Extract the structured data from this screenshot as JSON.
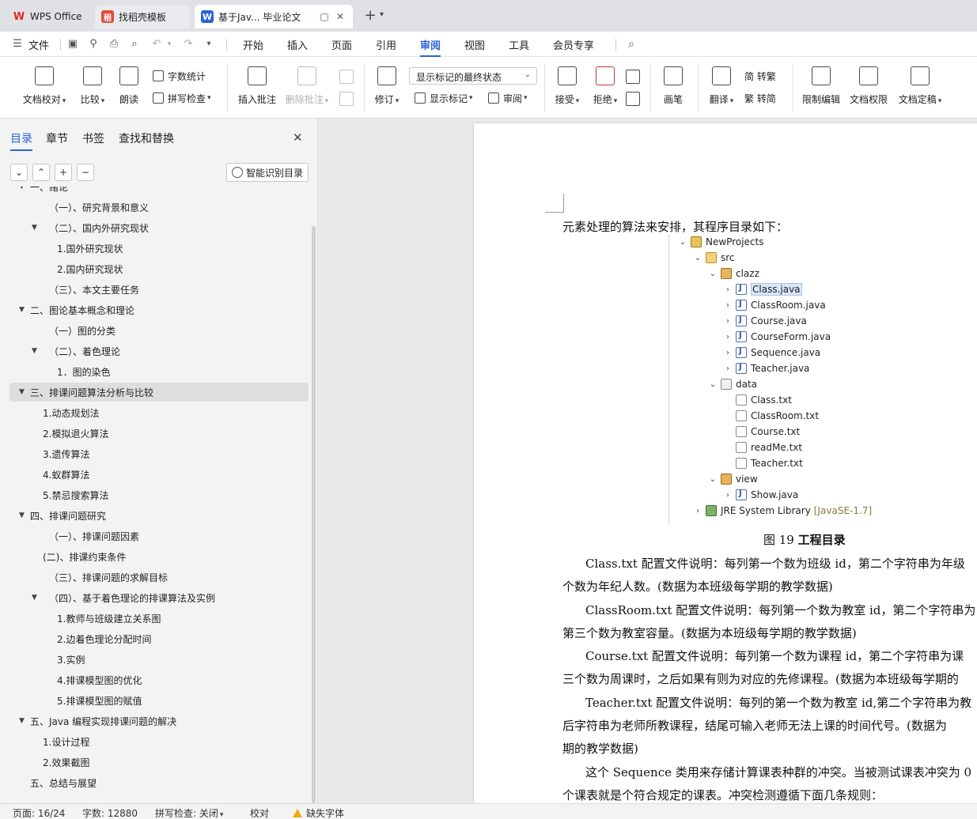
{
  "tabs": [
    {
      "label": "WPS Office",
      "icon": "wps-logo-icon"
    },
    {
      "label": "找稻壳模板",
      "icon": "docer-icon"
    },
    {
      "label": "基于Jav... 毕业论文",
      "icon": "word-doc-icon",
      "active": true
    }
  ],
  "menu": {
    "file": "文件",
    "items": [
      "开始",
      "插入",
      "页面",
      "引用",
      "审阅",
      "视图",
      "工具",
      "会员专享"
    ],
    "active": "审阅"
  },
  "ribbon": {
    "doc_check": "文档校对",
    "compare": "比较",
    "read_aloud": "朗读",
    "word_count": "字数统计",
    "spell_check": "拼写检查",
    "insert_comment": "插入批注",
    "delete_comment": "删除批注",
    "track": "修订",
    "markup_state": "显示标记的最终状态",
    "show_markup": "显示标记",
    "review_pane": "审阅",
    "accept": "接受",
    "reject": "拒绝",
    "pen": "画笔",
    "translate": "翻译",
    "to_traditional": "简 转繁",
    "to_simplified": "繁 转简",
    "restrict_edit": "限制编辑",
    "doc_permission": "文档权限",
    "finalize": "文档定稿"
  },
  "nav": {
    "tabs": [
      "目录",
      "章节",
      "书签",
      "查找和替换"
    ],
    "active_tab": "目录",
    "smart_toc": "智能识别目录",
    "toc": [
      {
        "label": "一、绪论",
        "level": 0,
        "expanded": true,
        "partial": true
      },
      {
        "label": "（一）、研究背景和意义",
        "level": 2
      },
      {
        "label": "（二）、国内外研究现状",
        "level": 1,
        "expanded": true
      },
      {
        "label": "1.国外研究现状",
        "level": 3
      },
      {
        "label": "2.国内研究现状",
        "level": 3
      },
      {
        "label": "（三）、本文主要任务",
        "level": 2
      },
      {
        "label": "二、图论基本概念和理论",
        "level": 0,
        "expanded": true
      },
      {
        "label": "（一）图的分类",
        "level": 2
      },
      {
        "label": "（二）、着色理论",
        "level": 1,
        "expanded": true
      },
      {
        "label": "1．图的染色",
        "level": 3
      },
      {
        "label": "三、排课问题算法分析与比较",
        "level": 0,
        "expanded": true,
        "selected": true
      },
      {
        "label": "1.动态规划法",
        "level": 4
      },
      {
        "label": "2.模拟退火算法",
        "level": 4
      },
      {
        "label": "3.遗传算法",
        "level": 4
      },
      {
        "label": "4.蚁群算法",
        "level": 4
      },
      {
        "label": "5.禁忌搜索算法",
        "level": 4
      },
      {
        "label": "四、排课问题研究",
        "level": 0,
        "expanded": true
      },
      {
        "label": "（一）、排课问题因素",
        "level": 2
      },
      {
        "label": "(二)、排课约束条件",
        "level": 4
      },
      {
        "label": "（三）、排课问题的求解目标",
        "level": 2
      },
      {
        "label": "（四）、基于着色理论的排课算法及实例",
        "level": 1,
        "expanded": true
      },
      {
        "label": "1.教师与班级建立关系图",
        "level": 3
      },
      {
        "label": "2.边着色理论分配时间",
        "level": 3
      },
      {
        "label": "3.实例",
        "level": 3
      },
      {
        "label": "4.排课模型图的优化",
        "level": 3
      },
      {
        "label": "5.排课模型图的赋值",
        "level": 3
      },
      {
        "label": "五、Java 编程实现排课问题的解决",
        "level": 0,
        "expanded": true
      },
      {
        "label": "1.设计过程",
        "level": 4
      },
      {
        "label": "2.效果截图",
        "level": 4
      },
      {
        "label": "五、总结与展望",
        "level": 5
      }
    ]
  },
  "document": {
    "intro": "元素处理的算法来安排，其程序目录如下：",
    "tree": [
      {
        "label": "NewProjects",
        "depth": 0,
        "arrow": "v",
        "icon": "project"
      },
      {
        "label": "src",
        "depth": 1,
        "arrow": "v",
        "icon": "folder"
      },
      {
        "label": "clazz",
        "depth": 2,
        "arrow": "v",
        "icon": "package"
      },
      {
        "label": "Class.java",
        "depth": 3,
        "arrow": ">",
        "icon": "java",
        "highlight": true
      },
      {
        "label": "ClassRoom.java",
        "depth": 3,
        "arrow": ">",
        "icon": "java"
      },
      {
        "label": "Course.java",
        "depth": 3,
        "arrow": ">",
        "icon": "java"
      },
      {
        "label": "CourseForm.java",
        "depth": 3,
        "arrow": ">",
        "icon": "java"
      },
      {
        "label": "Sequence.java",
        "depth": 3,
        "arrow": ">",
        "icon": "java"
      },
      {
        "label": "Teacher.java",
        "depth": 3,
        "arrow": ">",
        "icon": "java"
      },
      {
        "label": "data",
        "depth": 2,
        "arrow": "v",
        "icon": "datafolder"
      },
      {
        "label": "Class.txt",
        "depth": 3,
        "arrow": "",
        "icon": "txt"
      },
      {
        "label": "ClassRoom.txt",
        "depth": 3,
        "arrow": "",
        "icon": "txt"
      },
      {
        "label": "Course.txt",
        "depth": 3,
        "arrow": "",
        "icon": "txt"
      },
      {
        "label": "readMe.txt",
        "depth": 3,
        "arrow": "",
        "icon": "txt"
      },
      {
        "label": "Teacher.txt",
        "depth": 3,
        "arrow": "",
        "icon": "txt"
      },
      {
        "label": "view",
        "depth": 2,
        "arrow": "v",
        "icon": "package"
      },
      {
        "label": "Show.java",
        "depth": 3,
        "arrow": ">",
        "icon": "java"
      },
      {
        "label": "JRE System Library",
        "depth": 1,
        "arrow": ">",
        "icon": "lib",
        "suffix": "[JavaSE-1.7]"
      }
    ],
    "caption_num": "图 19",
    "caption_text": "工程目录",
    "paragraphs": [
      "Class.txt 配置文件说明：每列第一个数为班级 id，第二个字符串为年级",
      "个数为年纪人数。(数据为本班级每学期的教学数据)",
      "ClassRoom.txt 配置文件说明：每列第一个数为教室 id，第二个字符串为",
      "第三个数为教室容量。(数据为本班级每学期的教学数据)",
      "Course.txt 配置文件说明：每列第一个数为课程 id，第二个字符串为课",
      "三个数为周课时，之后如果有则为对应的先修课程。(数据为本班级每学期的",
      "Teacher.txt 配置文件说明：每列的第一个数为教室 id,第二个字符串为教",
      "后字符串为老师所教课程，结尾可输入老师无法上课的时间代号。(数据为",
      "期的教学数据)",
      "这个 Sequence 类用来存储计算课表种群的冲突。当被测试课表冲突为 0",
      "个课表就是个符合规定的课表。冲突检测遵循下面几条规则："
    ]
  },
  "status": {
    "page": "页面: 16/24",
    "words": "字数: 12880",
    "spell": "拼写检查: 关闭",
    "proof": "校对",
    "missing_font": "缺失字体"
  },
  "colors": {
    "accent": "#2b63d9",
    "selected_bg": "#dedede"
  }
}
